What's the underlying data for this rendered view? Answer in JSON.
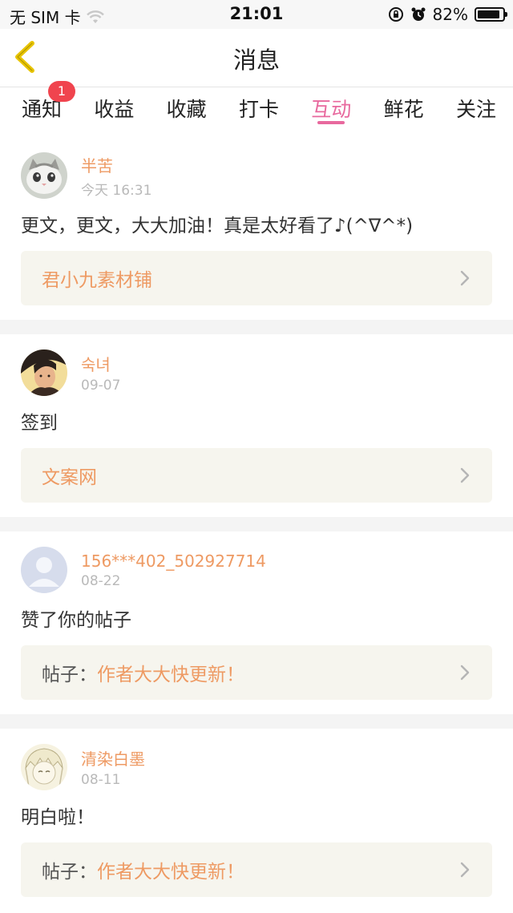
{
  "status_bar": {
    "carrier": "无 SIM 卡",
    "time": "21:01",
    "battery": "82%",
    "battery_level": 0.82,
    "icons": [
      "wifi-icon",
      "orientation-lock-icon",
      "alarm-icon",
      "battery-icon"
    ]
  },
  "nav": {
    "title": "消息",
    "back_icon": "chevron-left-icon",
    "accent": "#e8c400"
  },
  "tabs": [
    {
      "label": "通知",
      "badge": "1"
    },
    {
      "label": "收益"
    },
    {
      "label": "收藏"
    },
    {
      "label": "打卡"
    },
    {
      "label": "互动",
      "active": true
    },
    {
      "label": "鲜花"
    },
    {
      "label": "关注"
    }
  ],
  "colors": {
    "active_tab": "#e8699e",
    "username": "#ee9a63",
    "badge": "#f0444e",
    "box_bg": "#f6f5ee"
  },
  "messages": [
    {
      "user": "半苦",
      "date": "今天 16:31",
      "text": "更文，更文，大大加油！真是太好看了♪(^∇^*)",
      "box_prefix": "",
      "box_link": "君小九素材铺",
      "avatar": "cat-avatar"
    },
    {
      "user": "숙녀",
      "date": "09-07",
      "text": "签到",
      "box_prefix": "",
      "box_link": "文案网",
      "avatar": "girl-avatar"
    },
    {
      "user": "156***402_502927714",
      "date": "08-22",
      "text": "赞了你的帖子",
      "box_prefix": "帖子：",
      "box_link": "作者大大快更新！",
      "avatar": "default-user-avatar"
    },
    {
      "user": "清染白墨",
      "date": "08-11",
      "text": "明白啦！",
      "box_prefix": "帖子：",
      "box_link": "作者大大快更新！",
      "avatar": "anime-avatar"
    }
  ]
}
